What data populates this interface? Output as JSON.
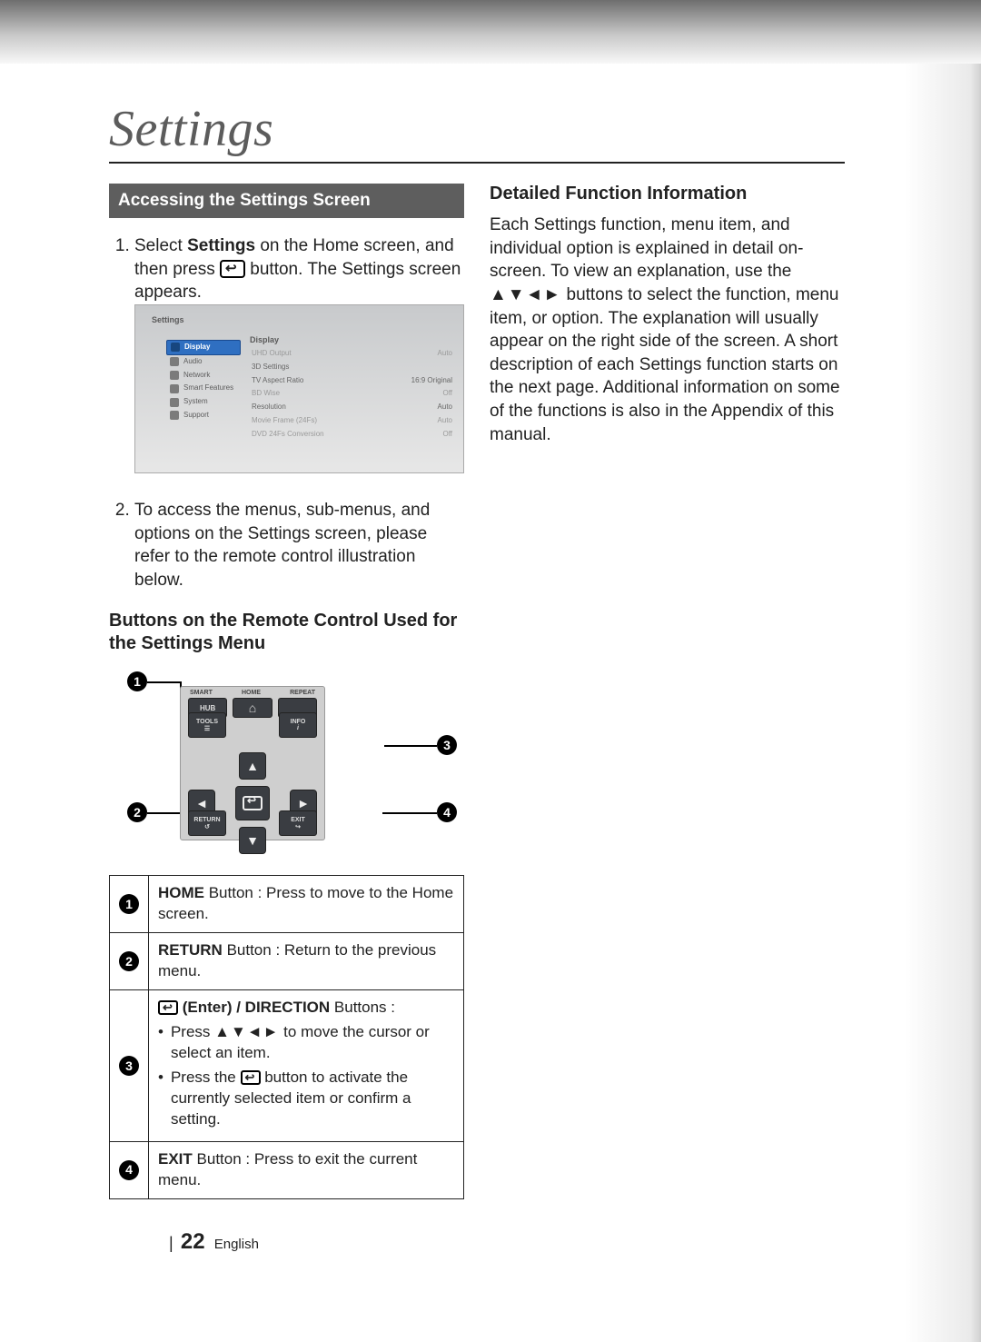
{
  "page_title": "Settings",
  "section_bar": "Accessing the Settings Screen",
  "steps": {
    "s1a": "Select ",
    "s1b": "Settings",
    "s1c": " on the Home screen, and then press ",
    "s1d": " button. The Settings screen appears.",
    "s2": "To access the menus, sub-menus, and options on the Settings screen, please refer to the remote control illustration below."
  },
  "subhead": "Buttons on the Remote Control Used for the Settings Menu",
  "tv": {
    "title": "Settings",
    "sidebar": [
      "Display",
      "Audio",
      "Network",
      "Smart Features",
      "System",
      "Support"
    ],
    "main_title": "Display",
    "rows": [
      {
        "l": "UHD Output",
        "v": "Auto"
      },
      {
        "l": "3D Settings",
        "v": ""
      },
      {
        "l": "TV Aspect Ratio",
        "v": "16:9 Original"
      },
      {
        "l": "BD Wise",
        "v": "Off"
      },
      {
        "l": "Resolution",
        "v": "Auto"
      },
      {
        "l": "Movie Frame (24Fs)",
        "v": "Auto"
      },
      {
        "l": "DVD 24Fs Conversion",
        "v": "Off"
      }
    ]
  },
  "remote": {
    "top_labels": [
      "SMART",
      "HOME",
      "REPEAT"
    ],
    "hub": "HUB",
    "tools": "TOOLS",
    "info": "INFO",
    "return": "RETURN",
    "exit": "EXIT",
    "callouts": [
      "1",
      "2",
      "3",
      "4"
    ]
  },
  "table": {
    "r1": {
      "n": "1",
      "b": "HOME",
      "t": " Button : Press to move to the Home screen."
    },
    "r2": {
      "n": "2",
      "b": "RETURN",
      "t": " Button : Return to the previous menu."
    },
    "r3": {
      "n": "3",
      "title_b": "(Enter) / DIRECTION",
      "title_t": " Buttons :",
      "b1a": "Press ",
      "b1arrows": "▲▼◄►",
      "b1b": " to move the cursor or select an item.",
      "b2a": "Press the ",
      "b2b": " button to activate the currently selected item or confirm a setting."
    },
    "r4": {
      "n": "4",
      "b": "EXIT",
      "t": " Button : Press to exit the current menu."
    }
  },
  "right": {
    "heading": "Detailed Function Information",
    "body_a": "Each Settings function, menu item, and individual option is explained in detail on-screen. To view an explanation, use the ",
    "arrows": "▲▼◄►",
    "body_b": " buttons to select the function, menu item, or option. The explanation will usually appear on the right side of the screen. A short description of each Settings function starts on the next page. Additional information on some of the functions is also in the Appendix of this manual."
  },
  "footer": {
    "bar": "|",
    "page": "22",
    "lang": "English"
  }
}
